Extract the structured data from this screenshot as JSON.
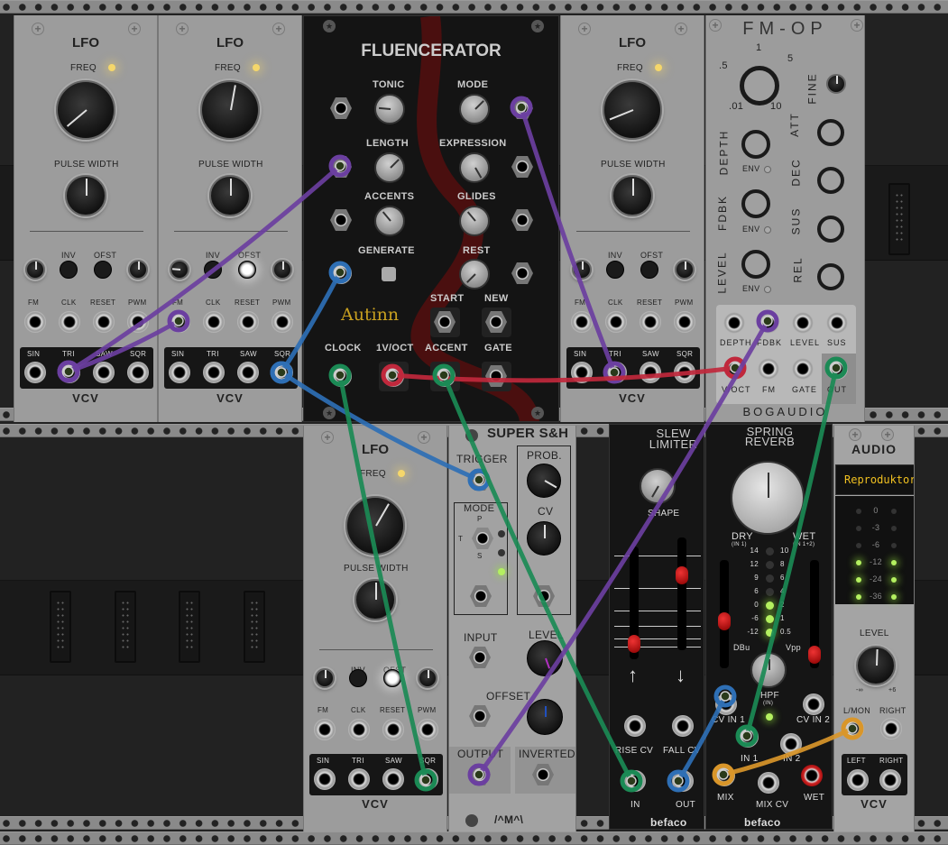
{
  "rack": {
    "modules": {
      "lfo1": {
        "title": "LFO",
        "freq_label": "FREQ",
        "pw_label": "PULSE WIDTH",
        "inv_label": "INV",
        "ofst_label": "OFST",
        "inputs": [
          "FM",
          "CLK",
          "RESET",
          "PWM"
        ],
        "outputs": [
          "SIN",
          "TRI",
          "SAW",
          "SQR"
        ],
        "brand": "VCV",
        "ofst_on": false
      },
      "lfo2": {
        "title": "LFO",
        "freq_label": "FREQ",
        "pw_label": "PULSE WIDTH",
        "inv_label": "INV",
        "ofst_label": "OFST",
        "inputs": [
          "FM",
          "CLK",
          "RESET",
          "PWM"
        ],
        "outputs": [
          "SIN",
          "TRI",
          "SAW",
          "SQR"
        ],
        "brand": "VCV",
        "ofst_on": true
      },
      "fluencerator": {
        "title": "FLUENCERATOR",
        "knobs": [
          "TONIC",
          "MODE",
          "LENGTH",
          "EXPRESSION",
          "ACCENTS",
          "GLIDES",
          "REST"
        ],
        "generate_label": "GENERATE",
        "start_label": "START",
        "new_label": "NEW",
        "outputs": [
          "CLOCK",
          "1V/OCT",
          "ACCENT",
          "GATE"
        ],
        "brand": "Autinn"
      },
      "lfo3": {
        "title": "LFO",
        "freq_label": "FREQ",
        "pw_label": "PULSE WIDTH",
        "inv_label": "INV",
        "ofst_label": "OFST",
        "inputs": [
          "FM",
          "CLK",
          "RESET",
          "PWM"
        ],
        "outputs": [
          "SIN",
          "TRI",
          "SAW",
          "SQR"
        ],
        "brand": "VCV",
        "ofst_on": false
      },
      "fmop": {
        "title": "FM-OP",
        "ratio_ticks": [
          ".5",
          "1",
          "5",
          ".01",
          "10"
        ],
        "fine_label": "FINE",
        "left_knobs": [
          "DEPTH",
          "FDBK",
          "LEVEL"
        ],
        "env_label": "ENV",
        "right_knobs": [
          "ATT",
          "DEC",
          "SUS",
          "REL"
        ],
        "scale_labels": [
          "1",
          "5",
          "0",
          "10"
        ],
        "jacks_row1": [
          "DEPTH",
          "FDBK",
          "LEVEL",
          "SUS"
        ],
        "jacks_row2": [
          "V/OCT",
          "FM",
          "GATE",
          "OUT"
        ],
        "brand": "BOGAUDIO"
      },
      "lfo4": {
        "title": "LFO",
        "freq_label": "FREQ",
        "pw_label": "PULSE WIDTH",
        "inv_label": "INV",
        "ofst_label": "OFST",
        "inputs": [
          "FM",
          "CLK",
          "RESET",
          "PWM"
        ],
        "outputs": [
          "SIN",
          "TRI",
          "SAW",
          "SQR"
        ],
        "brand": "VCV",
        "ofst_on": true
      },
      "supersh": {
        "title": "SUPER S&H",
        "trigger_label": "TRIGGER",
        "prob_label": "PROB.",
        "cv_label": "CV",
        "mode_label": "MODE",
        "mode_p": "P",
        "mode_t": "T",
        "mode_s": "S",
        "input_label": "INPUT",
        "level_label": "LEVEL",
        "offset_label": "OFFSET",
        "output_label": "OUTPUT",
        "inverted_label": "INVERTED",
        "brand": "/^M^\\"
      },
      "slew": {
        "title_line1": "SLEW",
        "title_line2": "LIMITER",
        "shape_label": "SHAPE",
        "rise_cv": "RISE CV",
        "fall_cv": "FALL CV",
        "in_label": "IN",
        "out_label": "OUT",
        "brand": "befaco"
      },
      "reverb": {
        "title_line1": "SPRING",
        "title_line2": "REVERB",
        "dry_label": "DRY",
        "dry_sub": "(IN 1)",
        "wet_label": "WET",
        "wet_sub": "(IN 1+2)",
        "dbu_scale": [
          "14",
          "12",
          "9",
          "6",
          "0",
          "-6",
          "-12"
        ],
        "vpp_scale": [
          "10",
          "8",
          "6",
          "4",
          "2",
          "1",
          "0.5"
        ],
        "dbu_label": "DBu",
        "vpp_label": "Vpp",
        "meter_lit_from": 4,
        "hpf_label": "HPF",
        "hpf_sub": "(IN)",
        "cv_in1": "CV IN 1",
        "cv_in2": "CV IN 2",
        "in1": "IN 1",
        "in2": "IN 2",
        "mix": "MIX",
        "mix_cv": "MIX CV",
        "wet": "WET",
        "brand": "befaco"
      },
      "audio": {
        "title": "AUDIO",
        "device": "Reproduktor",
        "meter_labels": [
          "0",
          "-3",
          "-6",
          "-12",
          "-24",
          "-36"
        ],
        "meter_lit_from": 3,
        "level_label": "LEVEL",
        "level_min": "-∞",
        "level_max": "+6",
        "in_labels": [
          "L/MON",
          "RIGHT"
        ],
        "out_labels": [
          "LEFT",
          "RIGHT"
        ],
        "brand": "VCV"
      }
    },
    "cables": [
      {
        "color": "#6b3fa0",
        "from": "lfo1.TRI",
        "to": "fluencerator.LENGTH-cv"
      },
      {
        "color": "#6b3fa0",
        "from": "lfo1.TRI",
        "to": "lfo2.FM"
      },
      {
        "color": "#2e6fb5",
        "from": "lfo2.SQR",
        "to": "fluencerator.GENERATE"
      },
      {
        "color": "#2e6fb5",
        "from": "lfo2.SQR",
        "to": "supersh.TRIGGER"
      },
      {
        "color": "#6b3fa0",
        "from": "fluencerator.MODE-cv",
        "to": "lfo3.TRI"
      },
      {
        "color": "#c0283c",
        "from": "fluencerator.1V/OCT",
        "to": "fmop.V/OCT"
      },
      {
        "color": "#1b8a55",
        "from": "fluencerator.CLOCK",
        "to": "lfo4.SQR"
      },
      {
        "color": "#1b8a55",
        "from": "fluencerator.ACCENT",
        "to": "slew.IN"
      },
      {
        "color": "#6b3fa0",
        "from": "fmop.FDBK",
        "to": "supersh.OUTPUT"
      },
      {
        "color": "#1b8a55",
        "from": "fmop.OUT",
        "to": "reverb.IN 1"
      },
      {
        "color": "#2e6fb5",
        "from": "slew.OUT",
        "to": "reverb.CV IN 1"
      },
      {
        "color": "#d9962a",
        "from": "reverb.MIX",
        "to": "audio.L/MON"
      }
    ]
  }
}
